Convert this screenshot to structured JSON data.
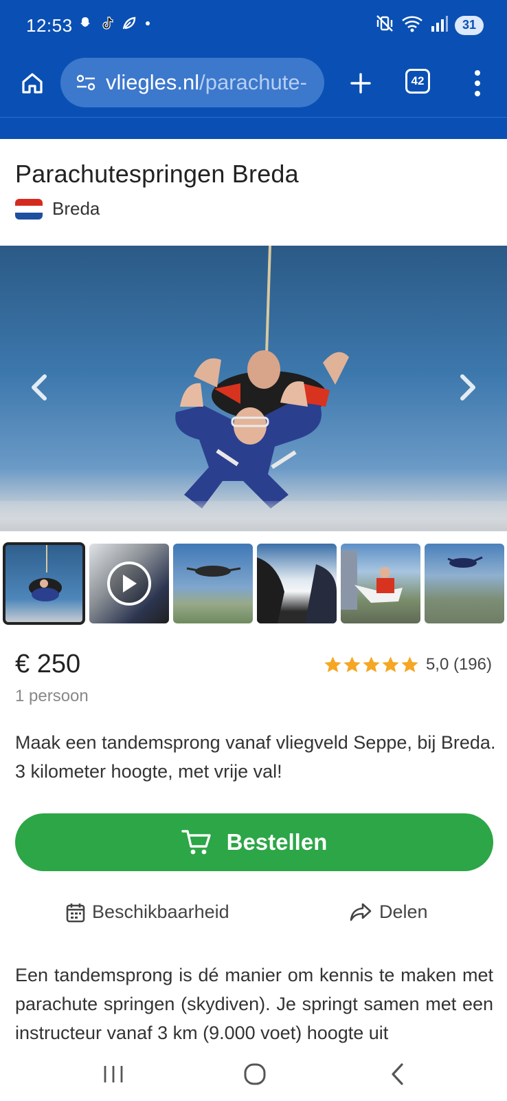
{
  "status_bar": {
    "time": "12:53",
    "notification_icons": [
      "snapchat-icon",
      "tiktok-icon",
      "leaf-icon",
      "dot-icon"
    ],
    "right_icons": [
      "mute-vibrate-icon",
      "wifi-6-icon",
      "signal-icon"
    ],
    "battery": "31"
  },
  "browser": {
    "url_host": "vliegles.nl",
    "url_path": "/parachute-",
    "tab_count": "42",
    "colors": {
      "bar": "#0a50b4",
      "url_pill": "#3c78cc"
    }
  },
  "product": {
    "title": "Parachutespringen Breda",
    "location": "Breda",
    "price": "€ 250",
    "per_unit": "1 persoon",
    "rating_value": "5,0 (196)",
    "stars": 5,
    "summary": "Maak een tandemsprong vanaf vliegveld Seppe, bij Breda. 3 kilometer hoogte, met vrije val!",
    "order_label": "Bestellen",
    "availability_label": "Beschikbaarheid",
    "share_label": "Delen",
    "description": "Een tandemsprong is dé manier om kennis te maken met parachute springen (skydiven). Je springt samen met een instructeur vanaf 3 km (9.000 voet) hoogte uit",
    "colors": {
      "order_button": "#2ca646",
      "star": "#f5a623"
    }
  },
  "gallery": {
    "thumbnail_count": 6,
    "active_index": 0,
    "video_index": 1
  }
}
